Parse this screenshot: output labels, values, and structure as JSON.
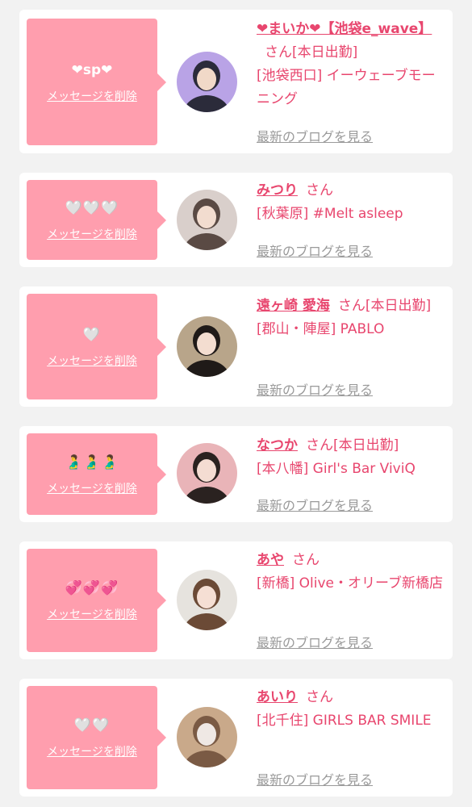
{
  "items": [
    {
      "bubble_text": "❤sp❤",
      "delete_label": "メッセージを削除",
      "name": "❤まいか❤【池袋e_wave】",
      "san": "さん",
      "status": "[本日出勤]",
      "location": "[池袋西口] イーウェーブモーニング",
      "blog_label": "最新のブログを見る",
      "avatar_colors": [
        "#b9a3e6",
        "#2b2b3a",
        "#f1d9c8"
      ]
    },
    {
      "bubble_text": "🤍🤍🤍",
      "delete_label": "メッセージを削除",
      "name": "みつり",
      "san": "さん",
      "status": "",
      "location": "[秋葉原] #Melt asleep",
      "blog_label": "最新のブログを見る",
      "avatar_colors": [
        "#d9cfcb",
        "#5a4a44",
        "#f2dccf"
      ]
    },
    {
      "bubble_text": "🤍",
      "delete_label": "メッセージを削除",
      "name": "遠ヶ崎 愛海",
      "san": "さん",
      "status": "[本日出勤]",
      "location": "[郡山・陣屋] PABLO",
      "blog_label": "最新のブログを見る",
      "avatar_colors": [
        "#b8a58a",
        "#1f1a18",
        "#f3ddd0"
      ]
    },
    {
      "bubble_text": "🫃🫃🫃",
      "delete_label": "メッセージを削除",
      "name": "なつか",
      "san": "さん",
      "status": "[本日出勤]",
      "location": "[本八幡] Girl's Bar ViviQ",
      "blog_label": "最新のブログを見る",
      "avatar_colors": [
        "#e9b4b8",
        "#2a2220",
        "#f4dcd2"
      ]
    },
    {
      "bubble_text": "💞💞💞",
      "delete_label": "メッセージを削除",
      "name": "あや",
      "san": "さん",
      "status": "",
      "location": "[新橋] Olive・オリーブ新橋店",
      "blog_label": "最新のブログを見る",
      "avatar_colors": [
        "#e6e3de",
        "#6b4a36",
        "#f5dfd4"
      ]
    },
    {
      "bubble_text": "🤍🤍",
      "delete_label": "メッセージを削除",
      "name": "あいり",
      "san": "さん",
      "status": "",
      "location": "[北千住] GIRLS BAR SMILE",
      "blog_label": "最新のブログを見る",
      "avatar_colors": [
        "#c9a98a",
        "#7a5a44",
        "#efe8e4"
      ]
    }
  ]
}
